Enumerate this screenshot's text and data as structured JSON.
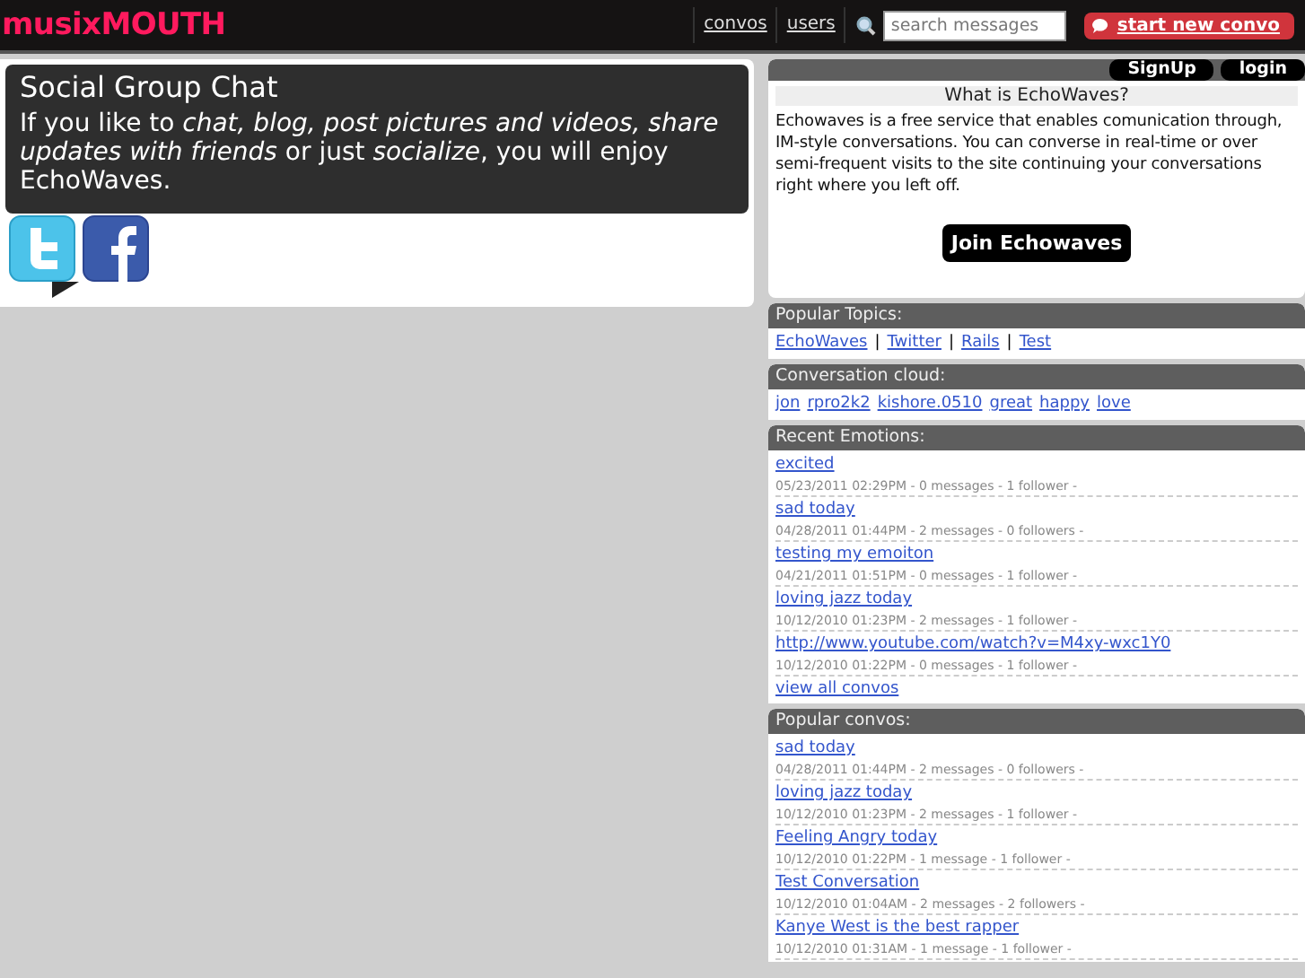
{
  "header": {
    "logo": "musixMOUTH",
    "nav": [
      {
        "label": "convos"
      },
      {
        "label": "users"
      }
    ],
    "search": {
      "placeholder": "search messages"
    },
    "new_convo": "start new convo"
  },
  "intro": {
    "title": "Social Group Chat",
    "text": "If you like to *chat, blog, post pictures and videos, share updates with friends* or just *socialize*, you will enjoy EchoWaves."
  },
  "account": {
    "buttons": [
      "SignUp",
      "login"
    ],
    "heading": "What is EchoWaves?",
    "text": "Echowaves is a free service that enables comunication through, IM-style conversations. You can converse in real-time or over semi-frequent visits to the site continuing your conversations right where you left off.",
    "join": "Join Echowaves"
  },
  "popular_topics": {
    "title": "Popular Topics:",
    "links": [
      "EchoWaves",
      "Twitter",
      "Rails",
      "Test"
    ],
    "separator": "|"
  },
  "conversation_cloud": {
    "title": "Conversation cloud:",
    "links": [
      "jon",
      "rpro2k2",
      "kishore.0510",
      "great",
      "happy",
      "love"
    ]
  },
  "recent_emotions": {
    "title": "Recent Emotions:",
    "items": [
      {
        "title": "excited",
        "meta": "05/23/2011 02:29PM - 0 messages - 1 follower -"
      },
      {
        "title": "sad today",
        "meta": "04/28/2011 01:44PM - 2 messages - 0 followers -"
      },
      {
        "title": "testing my emoiton",
        "meta": "04/21/2011 01:51PM - 0 messages - 1 follower -"
      },
      {
        "title": "loving jazz today",
        "meta": "10/12/2010 01:23PM - 2 messages - 1 follower -"
      },
      {
        "title": "http://www.youtube.com/watch?v=M4xy-wxc1Y0",
        "meta": "10/12/2010 01:22PM - 0 messages - 1 follower -"
      }
    ],
    "more": "view all convos"
  },
  "popular_convos": {
    "title": "Popular convos:",
    "items": [
      {
        "title": "sad today",
        "meta": "04/28/2011 01:44PM - 2 messages - 0 followers -"
      },
      {
        "title": "loving jazz today",
        "meta": "10/12/2010 01:23PM - 2 messages - 1 follower -"
      },
      {
        "title": "Feeling Angry today",
        "meta": "10/12/2010 01:22PM - 1 message - 1 follower -"
      },
      {
        "title": "Test Conversation",
        "meta": "10/12/2010 01:04AM - 2 messages - 2 followers -"
      },
      {
        "title": "Kanye West is the best rapper",
        "meta": "10/12/2010 01:31AM - 1 message - 1 follower -"
      }
    ]
  }
}
